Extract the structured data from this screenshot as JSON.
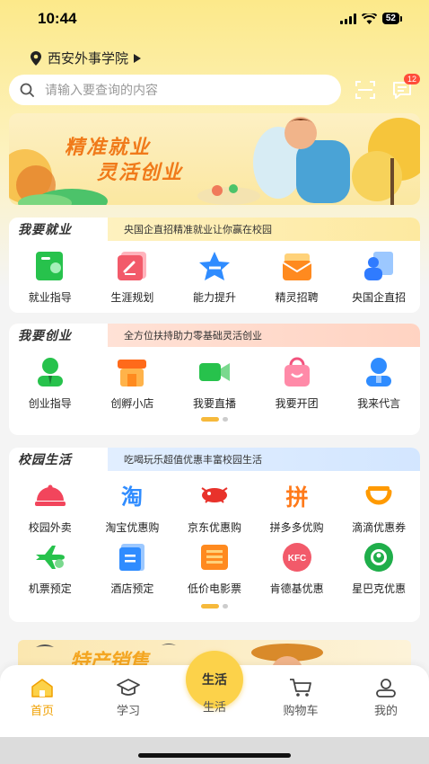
{
  "status": {
    "time": "10:44",
    "battery": "52"
  },
  "location": {
    "name": "西安外事学院"
  },
  "search": {
    "placeholder": "请输入要查询的内容"
  },
  "messages": {
    "badge": "12"
  },
  "banner": {
    "line1": "精准就业",
    "line2": "灵活创业"
  },
  "sections": [
    {
      "title": "我要就业",
      "subtitle": "央国企直招精准就业让你赢在校园",
      "items": [
        {
          "label": "就业指导",
          "icon": "job-guide-icon",
          "color": "#27c24c"
        },
        {
          "label": "生涯规划",
          "icon": "career-plan-icon",
          "color": "#f25a6a"
        },
        {
          "label": "能力提升",
          "icon": "skill-star-icon",
          "color": "#2f8cff"
        },
        {
          "label": "精灵招聘",
          "icon": "recruit-mail-icon",
          "color": "#ff8a1f"
        },
        {
          "label": "央国企直招",
          "icon": "soe-recruit-icon",
          "color": "#2f7bff"
        }
      ]
    },
    {
      "title": "我要创业",
      "subtitle": "全方位扶持助力零基础灵活创业",
      "items": [
        {
          "label": "创业指导",
          "icon": "startup-guide-icon",
          "color": "#27c24c"
        },
        {
          "label": "创孵小店",
          "icon": "shop-icon",
          "color": "#ff8a1f"
        },
        {
          "label": "我要直播",
          "icon": "live-camera-icon",
          "color": "#27c24c"
        },
        {
          "label": "我要开团",
          "icon": "group-bag-icon",
          "color": "#f2547e"
        },
        {
          "label": "我来代言",
          "icon": "ambassador-icon",
          "color": "#2f8cff"
        }
      ]
    },
    {
      "title": "校园生活",
      "subtitle": "吃喝玩乐超值优惠丰富校园生活",
      "items": [
        {
          "label": "校园外卖",
          "icon": "takeout-icon",
          "color": "#f2455c"
        },
        {
          "label": "淘宝优惠购",
          "icon": "taobao-icon",
          "color": "#2f8cff"
        },
        {
          "label": "京东优惠购",
          "icon": "jd-icon",
          "color": "#e8322b"
        },
        {
          "label": "拼多多优购",
          "icon": "pinduoduo-icon",
          "color": "#ff7a1a"
        },
        {
          "label": "滴滴优惠券",
          "icon": "didi-icon",
          "color": "#ff9a00"
        },
        {
          "label": "机票预定",
          "icon": "plane-icon",
          "color": "#27c24c"
        },
        {
          "label": "酒店预定",
          "icon": "hotel-icon",
          "color": "#2f8cff"
        },
        {
          "label": "低价电影票",
          "icon": "movie-ticket-icon",
          "color": "#ff8a1f"
        },
        {
          "label": "肯德基优惠",
          "icon": "kfc-icon",
          "color": "#f25a6a"
        },
        {
          "label": "星巴克优惠",
          "icon": "starbucks-icon",
          "color": "#1fae4a"
        }
      ]
    }
  ],
  "promo": {
    "title": "特产销售"
  },
  "tabbar": {
    "items": [
      {
        "label": "首页",
        "icon": "home-icon"
      },
      {
        "label": "学习",
        "icon": "study-cap-icon"
      },
      {
        "label": "生活",
        "icon": "life-icon"
      },
      {
        "label": "购物车",
        "icon": "cart-icon"
      },
      {
        "label": "我的",
        "icon": "profile-icon"
      }
    ],
    "center_label": "生活"
  }
}
